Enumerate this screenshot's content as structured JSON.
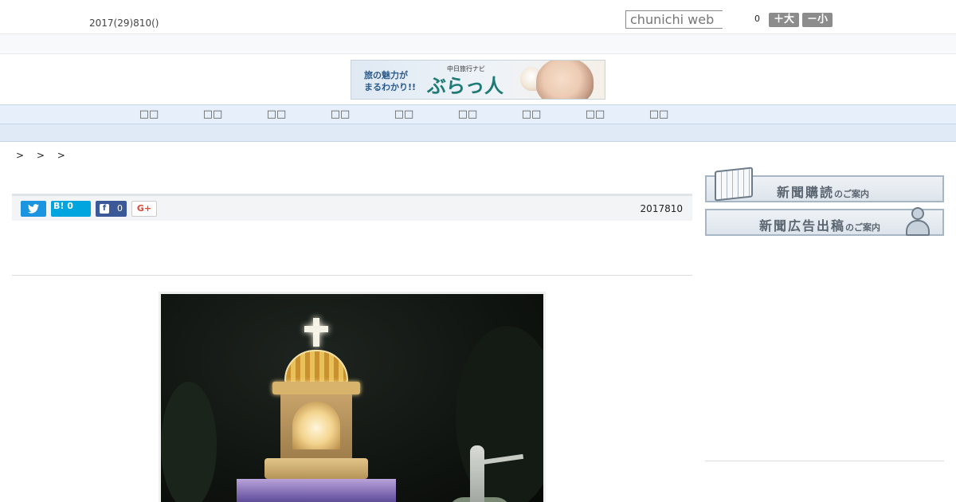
{
  "header": {
    "date": "2017(29)810()",
    "search_placeholder": "chunichi web",
    "count": "0",
    "font_large_label": "＋大",
    "font_small_label": "－小"
  },
  "banner": {
    "line1": "旅の魅力が",
    "line2": "まるわかり!!",
    "sub": "中日旅行ナビ",
    "logo": "ぶらっ人"
  },
  "nav": {
    "items": [
      {
        "label": "□□"
      },
      {
        "label": "□□"
      },
      {
        "label": "□□"
      },
      {
        "label": "□□"
      },
      {
        "label": "□□"
      },
      {
        "label": "□□"
      },
      {
        "label": "□□"
      },
      {
        "label": "□□"
      },
      {
        "label": "□□"
      }
    ]
  },
  "breadcrumb": "> > >",
  "share": {
    "hatena_label": "B!",
    "hatena_count": "0",
    "facebook_icon": "f",
    "facebook_count": "0",
    "gplus_label": "G+"
  },
  "article": {
    "date": "2017810"
  },
  "sidebar": {
    "subscribe": {
      "main": "新聞購読",
      "small": "のご案内"
    },
    "advertise": {
      "main": "新聞広告出稿",
      "small": "のご案内"
    }
  },
  "icons": {
    "twitter": "twitter-bird-icon",
    "subscribe": "newspaper-book-icon",
    "advertise": "person-icon"
  },
  "colors": {
    "twitter": "#1b95e0",
    "hatena": "#00a4de",
    "facebook": "#3b5998",
    "gplus": "#dd4b39",
    "nav_bg": "#e7f0fa"
  }
}
